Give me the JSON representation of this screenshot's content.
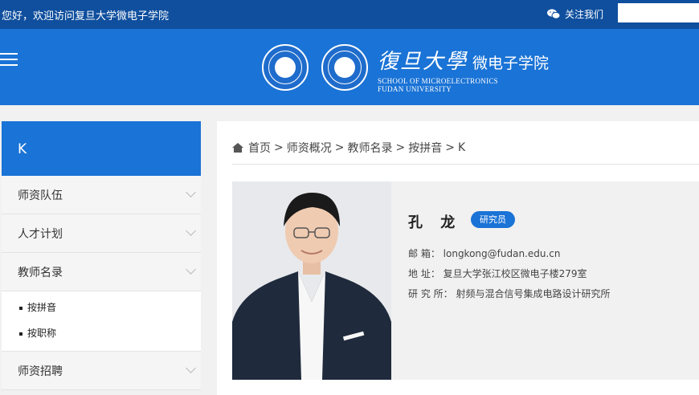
{
  "topbar": {
    "welcome": "您好，欢迎访问复旦大学微电子学院",
    "follow_label": "关注我们",
    "search_placeholder": ""
  },
  "header": {
    "seal_left_text": "FUDAN UNIVERSITY 1905",
    "brand_cn_main": "復旦大學",
    "brand_cn_school": "微电子学院",
    "brand_en_line1": "SCHOOL OF MICROELECTRONICS",
    "brand_en_line2": "FUDAN UNIVERSITY"
  },
  "sidebar": {
    "title": "K",
    "items": [
      {
        "label": "师资队伍"
      },
      {
        "label": "人才计划"
      },
      {
        "label": "教师名录"
      }
    ],
    "sub_items": [
      {
        "label": "按拼音"
      },
      {
        "label": "按职称"
      }
    ],
    "last_item": {
      "label": "师资招聘"
    }
  },
  "breadcrumb": {
    "items": [
      "首页",
      "师资概况",
      "教师名录",
      "按拼音",
      "K"
    ],
    "separator": ">"
  },
  "profile": {
    "name": "孔 龙",
    "title_badge": "研究员",
    "email_label": "邮 箱：",
    "email": "longkong@fudan.edu.cn",
    "address_label": "地 址：",
    "address": "复旦大学张江校区微电子楼279室",
    "institute_label": "研 究 所：",
    "institute": "射频与混合信号集成电路设计研究所"
  },
  "colors": {
    "topbar": "#0f4f9e",
    "header": "#1a73d6",
    "accent": "#1a73d6"
  }
}
